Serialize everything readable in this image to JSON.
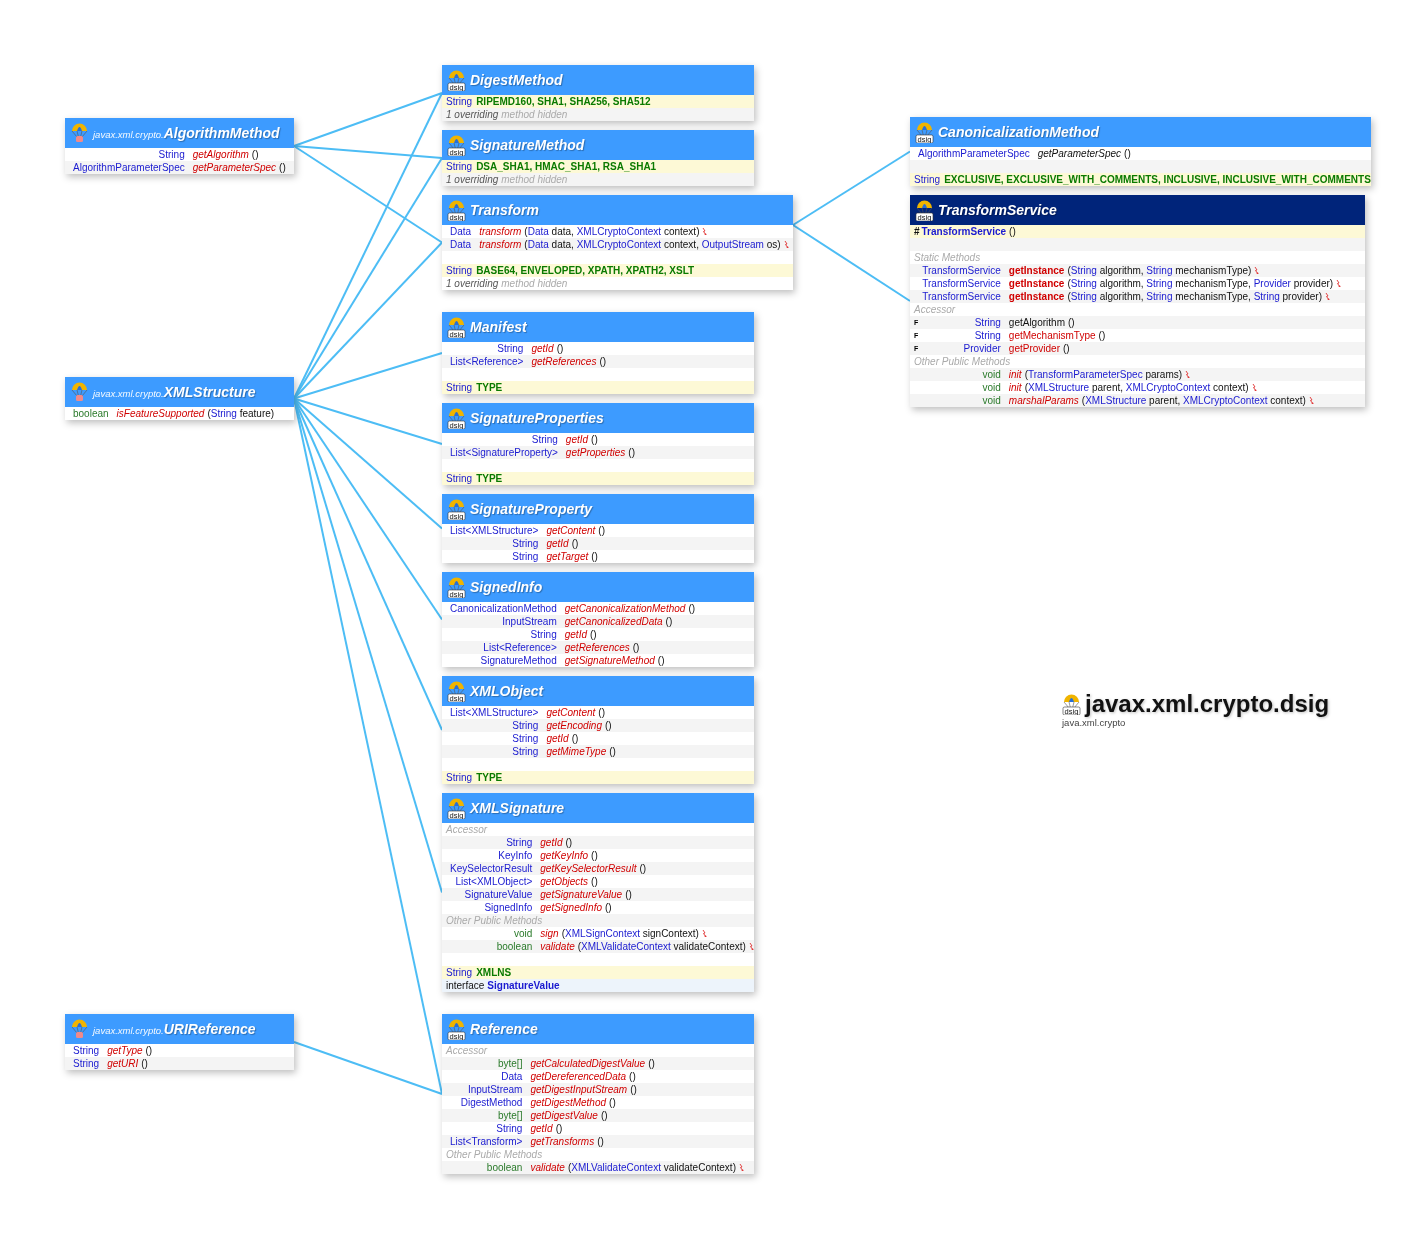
{
  "classes": [
    {
      "kind": "interface",
      "package": "javax.xml.crypto.",
      "name": "AlgorithmMethod",
      "rows": [
        {
          "kind": "abstract",
          "type": "String",
          "primitive": false,
          "name": "getAlgorithm",
          "params": [
            "()"
          ],
          "throws": false
        },
        {
          "kind": "abstract",
          "type": "AlgorithmParameterSpec",
          "primitive": false,
          "name": "getParameterSpec",
          "params": [
            "()"
          ],
          "throws": false
        }
      ]
    },
    {
      "kind": "interface",
      "package": "javax.xml.crypto.",
      "name": "XMLStructure",
      "rows": [
        {
          "kind": "abstract",
          "type": "boolean",
          "primitive": true,
          "name": "isFeatureSupported",
          "params": [
            "(",
            "String",
            " feature)"
          ],
          "throws": false
        }
      ]
    },
    {
      "kind": "interface",
      "package": "javax.xml.crypto.",
      "name": "URIReference",
      "rows": [
        {
          "kind": "abstract",
          "type": "String",
          "primitive": false,
          "name": "getType",
          "params": [
            "()"
          ],
          "throws": false
        },
        {
          "kind": "abstract",
          "type": "String",
          "primitive": false,
          "name": "getURI",
          "params": [
            "()"
          ],
          "throws": false
        }
      ]
    },
    {
      "kind": "interface",
      "icon_label": "dsig",
      "name": "DigestMethod",
      "rows": [
        {
          "kind": "field",
          "type": "String",
          "names": "RIPEMD160, SHA1, SHA256, SHA512"
        },
        {
          "kind": "note",
          "count": "1 overriding",
          "rest": "method hidden"
        }
      ]
    },
    {
      "kind": "interface",
      "icon_label": "dsig",
      "name": "SignatureMethod",
      "rows": [
        {
          "kind": "field",
          "type": "String",
          "names": "DSA_SHA1, HMAC_SHA1, RSA_SHA1"
        },
        {
          "kind": "note",
          "count": "1 overriding",
          "rest": "method hidden"
        }
      ]
    },
    {
      "kind": "interface",
      "icon_label": "dsig",
      "name": "Transform",
      "rows": [
        {
          "kind": "abstract",
          "type": "Data",
          "primitive": false,
          "name": "transform",
          "params": [
            "(",
            "Data",
            " data, ",
            "XMLCryptoContext",
            " context)"
          ],
          "throws": true
        },
        {
          "kind": "abstract",
          "type": "Data",
          "primitive": false,
          "name": "transform",
          "params": [
            "(",
            "Data",
            " data, ",
            "XMLCryptoContext",
            " context, ",
            "OutputStream",
            " os)"
          ],
          "throws": true
        },
        {
          "kind": "spacer"
        },
        {
          "kind": "field",
          "type": "String",
          "names": "BASE64, ENVELOPED, XPATH, XPATH2, XSLT"
        },
        {
          "kind": "note",
          "count": "1 overriding",
          "rest": "method hidden"
        }
      ]
    },
    {
      "kind": "interface",
      "icon_label": "dsig",
      "name": "Manifest",
      "rows": [
        {
          "kind": "abstract",
          "type": "String",
          "primitive": false,
          "name": "getId",
          "params": [
            "()"
          ],
          "throws": false
        },
        {
          "kind": "abstract",
          "type": "List<Reference>",
          "primitive": false,
          "name": "getReferences",
          "params": [
            "()"
          ],
          "throws": false
        },
        {
          "kind": "spacer"
        },
        {
          "kind": "field",
          "type": "String",
          "names": "TYPE"
        }
      ]
    },
    {
      "kind": "interface",
      "icon_label": "dsig",
      "name": "SignatureProperties",
      "rows": [
        {
          "kind": "abstract",
          "type": "String",
          "primitive": false,
          "name": "getId",
          "params": [
            "()"
          ],
          "throws": false
        },
        {
          "kind": "abstract",
          "type": "List<SignatureProperty>",
          "primitive": false,
          "name": "getProperties",
          "params": [
            "()"
          ],
          "throws": false
        },
        {
          "kind": "spacer"
        },
        {
          "kind": "field",
          "type": "String",
          "names": "TYPE"
        }
      ]
    },
    {
      "kind": "interface",
      "icon_label": "dsig",
      "name": "SignatureProperty",
      "rows": [
        {
          "kind": "abstract",
          "type": "List<XMLStructure>",
          "primitive": false,
          "name": "getContent",
          "params": [
            "()"
          ],
          "throws": false
        },
        {
          "kind": "abstract",
          "type": "String",
          "primitive": false,
          "name": "getId",
          "params": [
            "()"
          ],
          "throws": false
        },
        {
          "kind": "abstract",
          "type": "String",
          "primitive": false,
          "name": "getTarget",
          "params": [
            "()"
          ],
          "throws": false
        }
      ]
    },
    {
      "kind": "interface",
      "icon_label": "dsig",
      "name": "SignedInfo",
      "rows": [
        {
          "kind": "abstract",
          "type": "CanonicalizationMethod",
          "primitive": false,
          "name": "getCanonicalizationMethod",
          "params": [
            "()"
          ],
          "throws": false
        },
        {
          "kind": "abstract",
          "type": "InputStream",
          "primitive": false,
          "name": "getCanonicalizedData",
          "params": [
            "()"
          ],
          "throws": false
        },
        {
          "kind": "abstract",
          "type": "String",
          "primitive": false,
          "name": "getId",
          "params": [
            "()"
          ],
          "throws": false
        },
        {
          "kind": "abstract",
          "type": "List<Reference>",
          "primitive": false,
          "name": "getReferences",
          "params": [
            "()"
          ],
          "throws": false
        },
        {
          "kind": "abstract",
          "type": "SignatureMethod",
          "primitive": false,
          "name": "getSignatureMethod",
          "params": [
            "()"
          ],
          "throws": false
        }
      ]
    },
    {
      "kind": "interface",
      "icon_label": "dsig",
      "name": "XMLObject",
      "rows": [
        {
          "kind": "abstract",
          "type": "List<XMLStructure>",
          "primitive": false,
          "name": "getContent",
          "params": [
            "()"
          ],
          "throws": false
        },
        {
          "kind": "abstract",
          "type": "String",
          "primitive": false,
          "name": "getEncoding",
          "params": [
            "()"
          ],
          "throws": false
        },
        {
          "kind": "abstract",
          "type": "String",
          "primitive": false,
          "name": "getId",
          "params": [
            "()"
          ],
          "throws": false
        },
        {
          "kind": "abstract",
          "type": "String",
          "primitive": false,
          "name": "getMimeType",
          "params": [
            "()"
          ],
          "throws": false
        },
        {
          "kind": "spacer"
        },
        {
          "kind": "field",
          "type": "String",
          "names": "TYPE"
        }
      ]
    },
    {
      "kind": "interface",
      "icon_label": "dsig",
      "name": "XMLSignature",
      "rows": [
        {
          "kind": "section",
          "label": "Accessor"
        },
        {
          "kind": "abstract",
          "type": "String",
          "primitive": false,
          "name": "getId",
          "params": [
            "()"
          ],
          "throws": false
        },
        {
          "kind": "abstract",
          "type": "KeyInfo",
          "primitive": false,
          "name": "getKeyInfo",
          "params": [
            "()"
          ],
          "throws": false
        },
        {
          "kind": "abstract",
          "type": "KeySelectorResult",
          "primitive": false,
          "name": "getKeySelectorResult",
          "params": [
            "()"
          ],
          "throws": false
        },
        {
          "kind": "abstract",
          "type": "List<XMLObject>",
          "primitive": false,
          "name": "getObjects",
          "params": [
            "()"
          ],
          "throws": false
        },
        {
          "kind": "abstract",
          "type": "SignatureValue",
          "primitive": false,
          "name": "getSignatureValue",
          "params": [
            "()"
          ],
          "throws": false
        },
        {
          "kind": "abstract",
          "type": "SignedInfo",
          "primitive": false,
          "name": "getSignedInfo",
          "params": [
            "()"
          ],
          "throws": false
        },
        {
          "kind": "section",
          "label": "Other Public Methods"
        },
        {
          "kind": "abstract",
          "type": "void",
          "primitive": true,
          "name": "sign",
          "params": [
            "(",
            "XMLSignContext",
            " signContext)"
          ],
          "throws": true
        },
        {
          "kind": "abstract",
          "type": "boolean",
          "primitive": true,
          "name": "validate",
          "params": [
            "(",
            "XMLValidateContext",
            " validateContext)"
          ],
          "throws": true
        },
        {
          "kind": "spacer"
        },
        {
          "kind": "field",
          "type": "String",
          "names": "XMLNS"
        },
        {
          "kind": "nested",
          "keyword": "interface",
          "name": "SignatureValue"
        }
      ]
    },
    {
      "kind": "interface",
      "icon_label": "dsig",
      "name": "Reference",
      "rows": [
        {
          "kind": "section",
          "label": "Accessor"
        },
        {
          "kind": "abstract",
          "type": "byte[]",
          "primitive": true,
          "name": "getCalculatedDigestValue",
          "params": [
            "()"
          ],
          "throws": false
        },
        {
          "kind": "abstract",
          "type": "Data",
          "primitive": false,
          "name": "getDereferencedData",
          "params": [
            "()"
          ],
          "throws": false
        },
        {
          "kind": "abstract",
          "type": "InputStream",
          "primitive": false,
          "name": "getDigestInputStream",
          "params": [
            "()"
          ],
          "throws": false
        },
        {
          "kind": "abstract",
          "type": "DigestMethod",
          "primitive": false,
          "name": "getDigestMethod",
          "params": [
            "()"
          ],
          "throws": false
        },
        {
          "kind": "abstract",
          "type": "byte[]",
          "primitive": true,
          "name": "getDigestValue",
          "params": [
            "()"
          ],
          "throws": false
        },
        {
          "kind": "abstract",
          "type": "String",
          "primitive": false,
          "name": "getId",
          "params": [
            "()"
          ],
          "throws": false
        },
        {
          "kind": "abstract",
          "type": "List<Transform>",
          "primitive": false,
          "name": "getTransforms",
          "params": [
            "()"
          ],
          "throws": false
        },
        {
          "kind": "section",
          "label": "Other Public Methods"
        },
        {
          "kind": "abstract",
          "type": "boolean",
          "primitive": true,
          "name": "validate",
          "params": [
            "(",
            "XMLValidateContext",
            " validateContext)"
          ],
          "throws": true
        }
      ]
    },
    {
      "kind": "interface",
      "icon_label": "dsig",
      "name": "CanonicalizationMethod",
      "rows": [
        {
          "kind": "overriding",
          "type": "AlgorithmParameterSpec",
          "primitive": false,
          "name": "getParameterSpec",
          "params": [
            "()"
          ],
          "throws": false
        },
        {
          "kind": "spacer"
        },
        {
          "kind": "field",
          "type": "String",
          "names": "EXCLUSIVE, EXCLUSIVE_WITH_COMMENTS, INCLUSIVE, INCLUSIVE_WITH_COMMENTS"
        }
      ]
    },
    {
      "kind": "class",
      "icon_label": "dsig",
      "name": "TransformService",
      "rows": [
        {
          "kind": "constructor",
          "modifier": "#",
          "name": "TransformService",
          "params": [
            "()"
          ]
        },
        {
          "kind": "spacer"
        },
        {
          "kind": "section",
          "label": "Static Methods"
        },
        {
          "kind": "static",
          "type": "TransformService",
          "primitive": false,
          "name": "getInstance",
          "params": [
            "(",
            "String",
            " algorithm, ",
            "String",
            " mechanismType)"
          ],
          "throws": true
        },
        {
          "kind": "static",
          "type": "TransformService",
          "primitive": false,
          "name": "getInstance",
          "params": [
            "(",
            "String",
            " algorithm, ",
            "String",
            " mechanismType, ",
            "Provider",
            " provider)"
          ],
          "throws": true
        },
        {
          "kind": "static",
          "type": "TransformService",
          "primitive": false,
          "name": "getInstance",
          "params": [
            "(",
            "String",
            " algorithm, ",
            "String",
            " mechanismType, ",
            "String",
            " provider)"
          ],
          "throws": true
        },
        {
          "kind": "section",
          "label": "Accessor"
        },
        {
          "kind": "inherited",
          "modifier": "F",
          "type": "String",
          "primitive": false,
          "name": "getAlgorithm",
          "params": [
            "()"
          ],
          "throws": false
        },
        {
          "kind": "concrete",
          "modifier": "F",
          "type": "String",
          "primitive": false,
          "name": "getMechanismType",
          "params": [
            "()"
          ],
          "throws": false
        },
        {
          "kind": "concrete",
          "modifier": "F",
          "type": "Provider",
          "primitive": false,
          "name": "getProvider",
          "params": [
            "()"
          ],
          "throws": false
        },
        {
          "kind": "section",
          "label": "Other Public Methods"
        },
        {
          "kind": "abstract",
          "type": "void",
          "primitive": true,
          "name": "init",
          "params": [
            "(",
            "TransformParameterSpec",
            " params)"
          ],
          "throws": true
        },
        {
          "kind": "abstract",
          "type": "void",
          "primitive": true,
          "name": "init",
          "params": [
            "(",
            "XMLStructure",
            " parent, ",
            "XMLCryptoContext",
            " context)"
          ],
          "throws": true
        },
        {
          "kind": "abstract",
          "type": "void",
          "primitive": true,
          "name": "marshalParams",
          "params": [
            "(",
            "XMLStructure",
            " parent, ",
            "XMLCryptoContext",
            " context)"
          ],
          "throws": true
        }
      ]
    }
  ],
  "package": {
    "icon_label": "dsig",
    "name": "javax.xml.crypto.dsig",
    "module": "java.xml.crypto"
  }
}
